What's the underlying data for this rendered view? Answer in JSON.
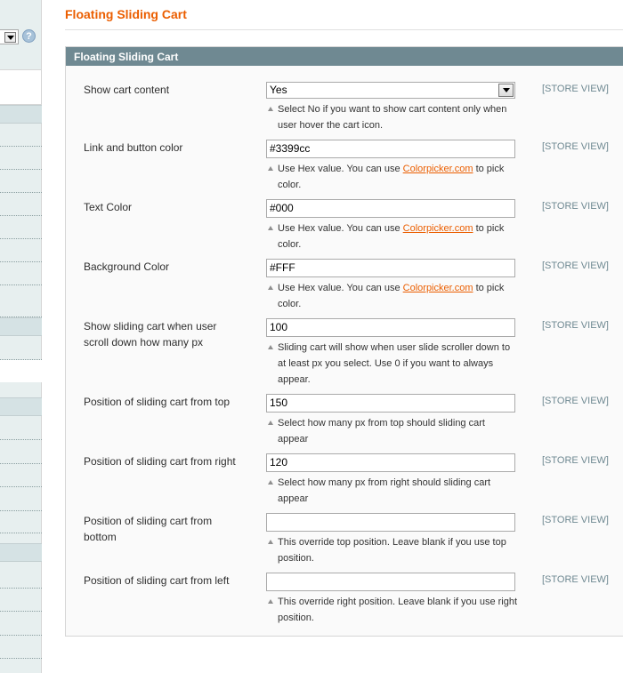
{
  "sidebar": {
    "help_icon": "?"
  },
  "page": {
    "title": "Floating Sliding Cart"
  },
  "section": {
    "title": "Floating Sliding Cart",
    "scope_label": "[STORE VIEW]",
    "fields": [
      {
        "label": "Show cart content",
        "type": "select",
        "value": "Yes",
        "note": "Select No if you want to show cart content only when user hover the cart icon."
      },
      {
        "label": "Link and button color",
        "type": "text",
        "value": "#3399cc",
        "note_pre": "Use Hex value. You can use ",
        "note_link": "Colorpicker.com",
        "note_post": " to pick color."
      },
      {
        "label": "Text Color",
        "type": "text",
        "value": "#000",
        "note_pre": "Use Hex value. You can use ",
        "note_link": "Colorpicker.com",
        "note_post": " to pick color."
      },
      {
        "label": "Background Color",
        "type": "text",
        "value": "#FFF",
        "note_pre": "Use Hex value. You can use ",
        "note_link": "Colorpicker.com",
        "note_post": " to pick color."
      },
      {
        "label": "Show sliding cart when user scroll down how many px",
        "type": "text",
        "value": "100",
        "note": "Sliding cart will show when user slide scroller down to at least px you select. Use 0 if you want to always appear."
      },
      {
        "label": "Position of sliding cart from top",
        "type": "text",
        "value": "150",
        "note": "Select how many px from top should sliding cart appear"
      },
      {
        "label": "Position of sliding cart from right",
        "type": "text",
        "value": "120",
        "note": "Select how many px from right should sliding cart appear"
      },
      {
        "label": "Position of sliding cart from bottom",
        "type": "text",
        "value": "",
        "note": "This override top position. Leave blank if you use top position."
      },
      {
        "label": "Position of sliding cart from left",
        "type": "text",
        "value": "",
        "note": "This override right position. Leave blank if you use right position."
      }
    ]
  },
  "colors": {
    "title": "#eb5e00",
    "section_header_bg": "#6f8992",
    "link": "#eb5e00",
    "scope": "#6f8992"
  }
}
